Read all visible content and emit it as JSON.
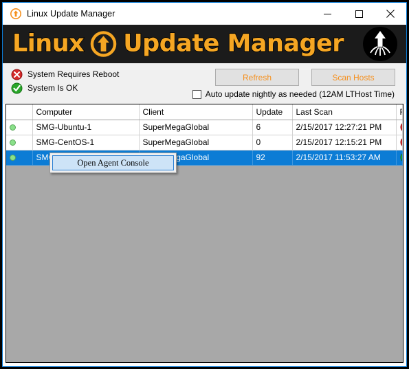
{
  "window": {
    "title": "Linux Update Manager",
    "icon": "up-arrow-circle-icon",
    "minimize_label": "Minimize",
    "maximize_label": "Maximize",
    "close_label": "Close"
  },
  "banner": {
    "word1": "Linux",
    "word2": "Update Manager",
    "arrow_icon": "up-arrow-circle-icon",
    "brand_icon": "squid-icon",
    "background": "#1b1b1b",
    "accent": "#f5a623"
  },
  "toolbar": {
    "legend": [
      {
        "icon": "red-x-circle-icon",
        "label": "System Requires Reboot",
        "color": "#d42a2a"
      },
      {
        "icon": "green-check-circle-icon",
        "label": "System Is OK",
        "color": "#2aa62a"
      }
    ],
    "refresh_label": "Refresh",
    "scan_hosts_label": "Scan Hosts",
    "button_text_color": "#f5901e",
    "autoupdate_label": "Auto update nightly as needed (12AM LTHost Time)",
    "autoupdate_checked": false
  },
  "grid": {
    "columns": [
      "",
      "Computer",
      "Client",
      "Update",
      "Last Scan",
      "RB"
    ],
    "rows": [
      {
        "status": "online-dot",
        "computer": "SMG-Ubuntu-1",
        "client": "SuperMegaGlobal",
        "update": "6",
        "last_scan": "2/15/2017 12:27:21 PM",
        "rb": "red-x-circle-icon",
        "selected": false
      },
      {
        "status": "online-dot",
        "computer": "SMG-CentOS-1",
        "client": "SuperMegaGlobal",
        "update": "0",
        "last_scan": "2/15/2017 12:15:21 PM",
        "rb": "red-x-circle-icon",
        "selected": false
      },
      {
        "status": "online-dot",
        "computer": "SMG-",
        "client": "SuperMegaGlobal",
        "update": "92",
        "last_scan": "2/15/2017 11:53:27 AM",
        "rb": "green-check-circle-icon",
        "selected": true
      }
    ],
    "selection_color": "#0c7cd5",
    "empty_background": "#a8a8a8"
  },
  "context_menu": {
    "items": [
      {
        "label": "Open Agent Console",
        "highlighted": true
      }
    ]
  }
}
